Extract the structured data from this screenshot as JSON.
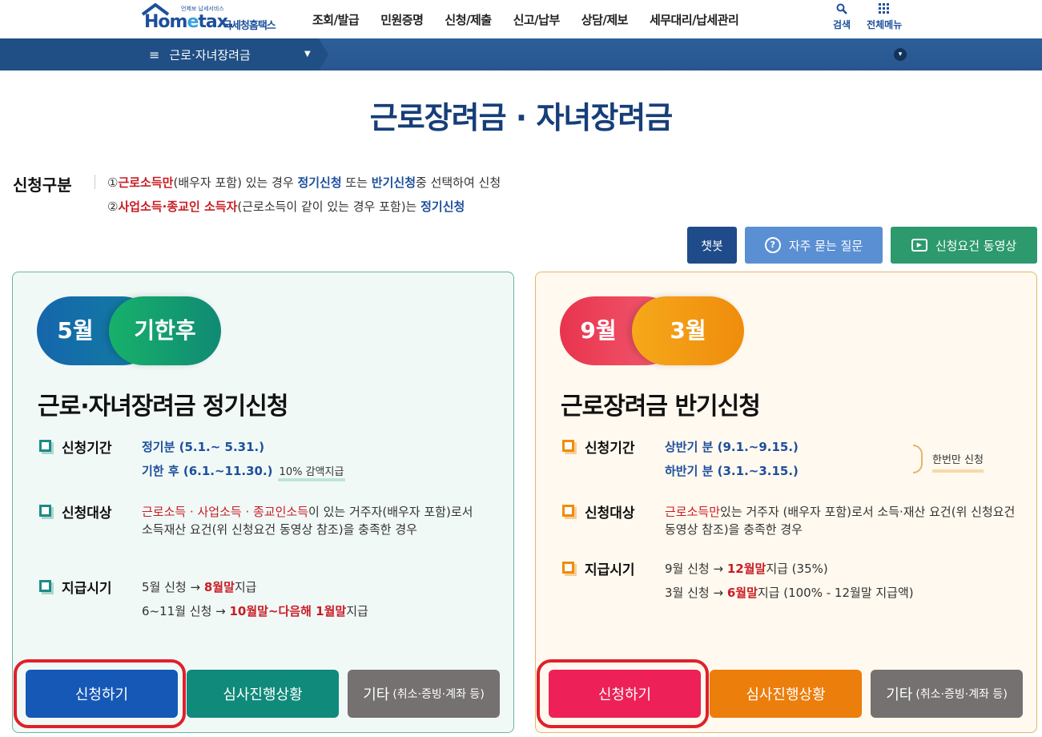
{
  "header": {
    "logo_small": "언제보 납세서비스",
    "logo_main_1": "Hom",
    "logo_main_e": "e",
    "logo_main_2": "tax.",
    "logo_ko": "국세청홈택스",
    "menu": [
      "조회/발급",
      "민원증명",
      "신청/제출",
      "신고/납부",
      "상담/제보",
      "세무대리/납세관리"
    ],
    "search_label": "검색",
    "allmenu_label": "전체메뉴"
  },
  "subbar": {
    "title": "근로·자녀장려금"
  },
  "page_title": "근로장려금 · 자녀장려금",
  "apptype": {
    "label": "신청구분",
    "line1": {
      "num": "①",
      "red": "근로소득만",
      "t1": "(배우자 포함) 있는 경우 ",
      "b1": "정기신청",
      "t2": " 또는 ",
      "b2": "반기신청",
      "t3": "중 선택하여 신청"
    },
    "line2": {
      "num": "②",
      "red": "사업소득·종교인 소득자",
      "t1": "(근로소득이 같이 있는 경우 포함)는 ",
      "b1": "정기신청"
    }
  },
  "help_buttons": {
    "chatbot": "챗봇",
    "faq": "자주 묻는 질문",
    "video": "신청요건 동영상"
  },
  "cards": {
    "left": {
      "pill1": "5월",
      "pill2": "기한후",
      "title": "근로·자녀장려금 정기신청",
      "period_label": "신청기간",
      "period_1": "정기분 (5.1.~ 5.31.)",
      "period_2": "기한 후 (6.1.~11.30.)",
      "period_2_note": "10% 감액지급",
      "target_label": "신청대상",
      "target_red": "근로소득 · 사업소득 · 종교인소득",
      "target_text": "이 있는 거주자(배우자 포함)로서 소득재산 요건(위 신청요건 동영상 참조)을 충족한 경우",
      "pay_label": "지급시기",
      "pay_1_a": "5월 신청 → ",
      "pay_1_red": "8월말",
      "pay_1_b": "지급",
      "pay_2_a": "6~11월 신청 → ",
      "pay_2_red1": "10월말~다음해 ",
      "pay_2_red2": "1월말",
      "pay_2_b": "지급",
      "btn_apply": "신청하기",
      "btn_status": "심사진행상황",
      "btn_other": "기타",
      "btn_other_small": "(취소·증빙·계좌 등)"
    },
    "right": {
      "pill1": "9월",
      "pill2": "3월",
      "title": "근로장려금 반기신청",
      "period_label": "신청기간",
      "period_1": "상반기 분 (9.1.~9.15.)",
      "period_2": "하반기 분 (3.1.~3.15.)",
      "period_note": "한번만 신청",
      "target_label": "신청대상",
      "target_red": "근로소득만",
      "target_text": "있는 거주자 (배우자 포함)로서 소득·재산 요건(위 신청요건 동영상 참조)을 충족한 경우",
      "pay_label": "지급시기",
      "pay_1_a": "9월 신청 → ",
      "pay_1_red": "12월말",
      "pay_1_b": "지급 (35%)",
      "pay_2_a": "3월 신청 → ",
      "pay_2_red": "6월말",
      "pay_2_b": "지급 (100% - 12월말 지급액)",
      "btn_apply": "신청하기",
      "btn_status": "심사진행상황",
      "btn_other": "기타",
      "btn_other_small": "(취소·증빙·계좌 등)"
    }
  }
}
